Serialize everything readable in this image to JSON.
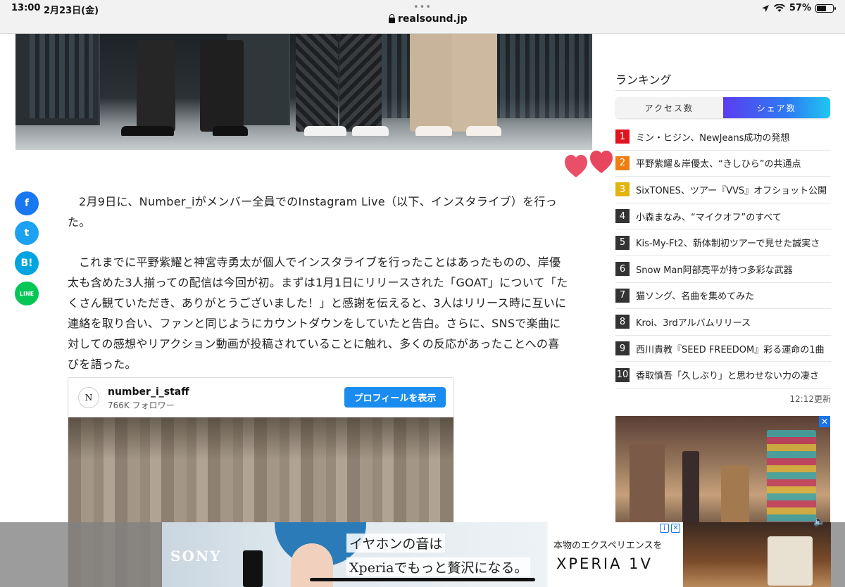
{
  "status_bar": {
    "time": "13:00",
    "date": "2月23日(金)",
    "dots": "•••",
    "url": "realsound.jp",
    "battery_text": "57%",
    "battery_level": 0.57
  },
  "share_buttons": [
    {
      "name": "facebook",
      "label": "f",
      "color": "#1877f2"
    },
    {
      "name": "twitter",
      "label": "t",
      "color": "#1da1f2"
    },
    {
      "name": "hatena",
      "label": "B!",
      "color": "#00a4de"
    },
    {
      "name": "line",
      "label": "LINE",
      "color": "#06c755"
    }
  ],
  "article": {
    "paragraphs": [
      "2月9日に、Number_iがメンバー全員でのInstagram Live（以下、インスタライブ）を行った。",
      "これまでに平野紫耀と神宮寺勇太が個人でインスタライブを行ったことはあったものの、岸優太も含めた3人揃っての配信は今回が初。まずは1月1日にリリースされた「GOAT」について「たくさん観ていただき、ありがとうございました！」と感謝を伝えると、3人はリリース時に互いに連絡を取り合い、ファンと同じようにカウントダウンをしていたと告白。さらに、SNSで楽曲に対しての感想やリアクション動画が投稿されていることに触れ、多くの反応があったことへの喜びを語った。"
    ]
  },
  "instagram": {
    "logo": "N",
    "username": "number_i_staff",
    "followers": "766K フォロワー",
    "button": "プロフィールを表示"
  },
  "ranking": {
    "title": "ランキング",
    "tab_access": "アクセス数",
    "tab_share": "シェア数",
    "items": [
      {
        "num": "1",
        "text": "ミン・ヒジン、NewJeans成功の発想",
        "color": "#e0141e"
      },
      {
        "num": "2",
        "text": "平野紫耀＆岸優太、“きしひら”の共通点",
        "color": "#ef7d12"
      },
      {
        "num": "3",
        "text": "SixTONES、ツアー『VVS』オフショット公開",
        "color": "#e2b40f"
      },
      {
        "num": "4",
        "text": "小森まなみ、“マイクオフ”のすべて",
        "color": "#333333"
      },
      {
        "num": "5",
        "text": "Kis-My-Ft2、新体制初ツアーで見せた誠実さ",
        "color": "#333333"
      },
      {
        "num": "6",
        "text": "Snow Man阿部亮平が持つ多彩な武器",
        "color": "#333333"
      },
      {
        "num": "7",
        "text": "猫ソング、名曲を集めてみた",
        "color": "#333333"
      },
      {
        "num": "8",
        "text": "Kroi、3rdアルバムリリース",
        "color": "#333333"
      },
      {
        "num": "9",
        "text": "西川貴教『SEED FREEDOM』彩る運命の1曲",
        "color": "#333333"
      },
      {
        "num": "10",
        "text": "香取慎吾「久しぶり」と思わせない力の凄さ",
        "color": "#333333"
      }
    ],
    "updated": "12:12更新"
  },
  "ad_banner": {
    "brand": "SONY",
    "headline_1": "イヤホンの音は",
    "headline_2": "Xperiaでもっと贅沢になる。",
    "tagline": "本物のエクスペリエンスを",
    "product": "XPERIA 1V",
    "info_icon": "i",
    "close_icon": "✕"
  },
  "video_ad": {
    "close": "✕"
  }
}
